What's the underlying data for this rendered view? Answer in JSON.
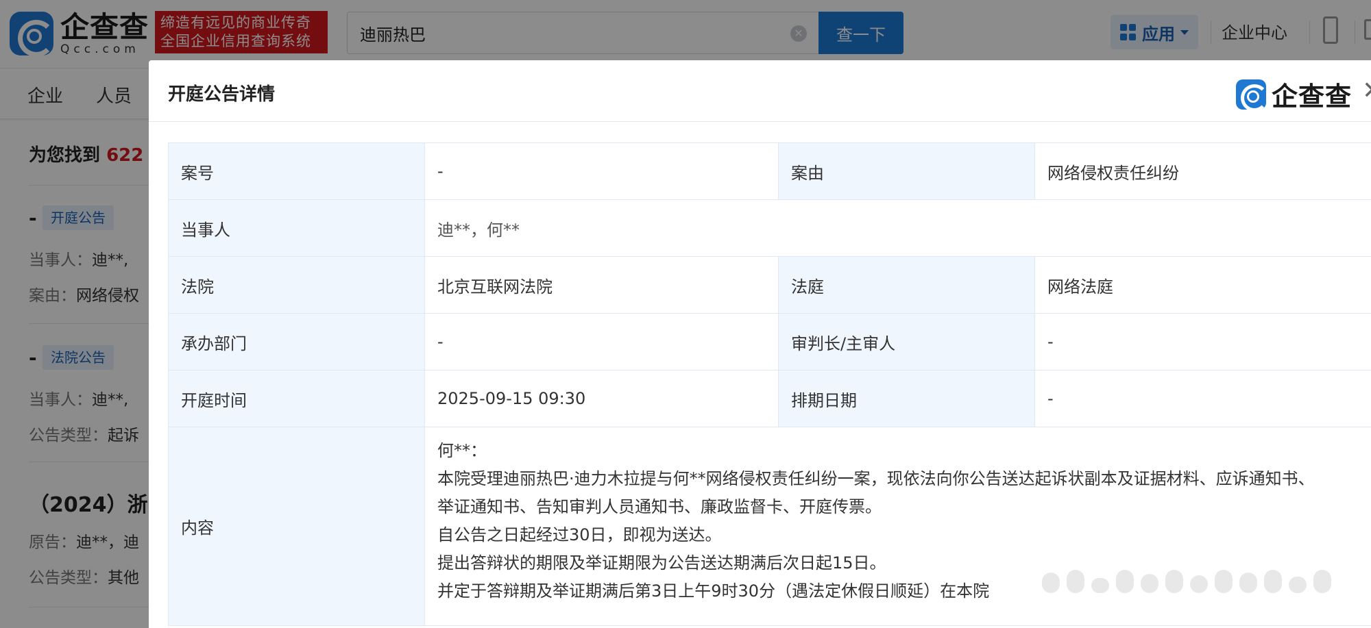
{
  "header": {
    "logo_cn": "企查查",
    "logo_en": "Qcc.com",
    "slogan_line1": "缔造有远见的商业传奇",
    "slogan_line2": "全国企业信用查询系统",
    "search_value": "迪丽热巴",
    "search_button": "查一下",
    "apps_label": "应用",
    "enterprise_center": "企业中心"
  },
  "nav": {
    "items": [
      "企业",
      "人员"
    ]
  },
  "results": {
    "count_prefix": "为您找到",
    "count": "622",
    "items": [
      {
        "dash": "-",
        "tag": "开庭公告",
        "line1_label": "当事人：",
        "line1_value": "迪**,",
        "line2_label": "案由：",
        "line2_value": "网络侵权"
      },
      {
        "dash": "-",
        "tag": "法院公告",
        "line1_label": "当事人：",
        "line1_value": "迪**,",
        "line2_label": "公告类型：",
        "line2_value": "起诉"
      },
      {
        "title": "（2024）浙",
        "line1_label": "原告：",
        "line1_value": "迪**，迪",
        "line2_label": "公告类型：",
        "line2_value": "其他"
      }
    ]
  },
  "modal": {
    "title": "开庭公告详情",
    "logo_text": "企查查",
    "close": "✕",
    "rows": {
      "case_no_label": "案号",
      "case_no_value": "-",
      "cause_label": "案由",
      "cause_value": "网络侵权责任纠纷",
      "parties_label": "当事人",
      "parties_value": "迪**，何**",
      "court_label": "法院",
      "court_value": "北京互联网法院",
      "tribunal_label": "法庭",
      "tribunal_value": "网络法庭",
      "dept_label": "承办部门",
      "dept_value": "-",
      "judge_label": "审判长/主审人",
      "judge_value": "-",
      "time_label": "开庭时间",
      "time_value": "2025-09-15 09:30",
      "schedule_label": "排期日期",
      "schedule_value": "-",
      "content_label": "内容",
      "content_lines": [
        "何**：",
        "本院受理迪丽热巴·迪力木拉提与何**网络侵权责任纠纷一案，现依法向你公告送达起诉状副本及证据材料、应诉通知书、",
        "举证通知书、告知审判人员通知书、廉政监督卡、开庭传票。",
        "自公告之日起经过30日，即视为送达。",
        "提出答辩状的期限及举证期限为公告送达期满后次日起15日。",
        "并定于答辩期及举证期满后第3日上午9时30分（遇法定休假日顺延）在本院"
      ]
    }
  }
}
